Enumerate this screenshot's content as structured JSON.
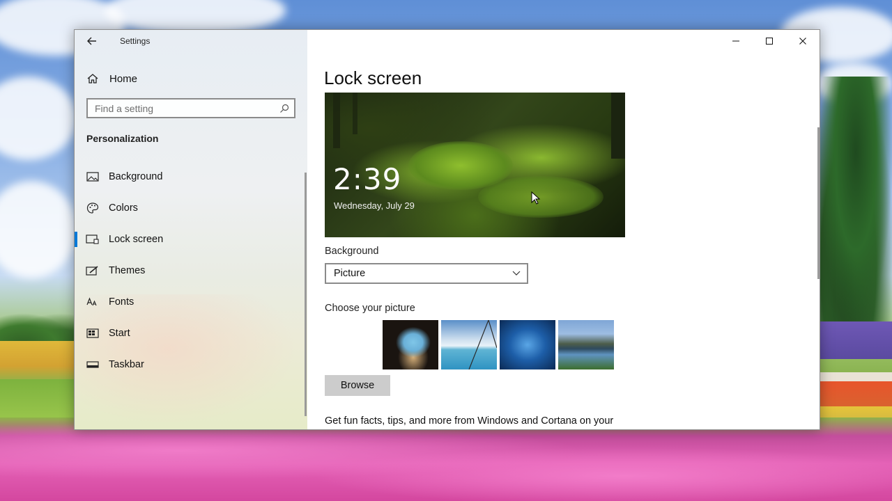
{
  "window": {
    "title": "Settings",
    "caption": {
      "minimize_icon": "minimize-icon",
      "maximize_icon": "maximize-icon",
      "close_icon": "close-icon"
    }
  },
  "sidebar": {
    "home_label": "Home",
    "search": {
      "placeholder": "Find a setting",
      "value": ""
    },
    "section_title": "Personalization",
    "items": [
      {
        "label": "Background",
        "icon": "picture-icon",
        "active": false
      },
      {
        "label": "Colors",
        "icon": "palette-icon",
        "active": false
      },
      {
        "label": "Lock screen",
        "icon": "lock-screen-icon",
        "active": true
      },
      {
        "label": "Themes",
        "icon": "brush-icon",
        "active": false
      },
      {
        "label": "Fonts",
        "icon": "font-icon",
        "active": false
      },
      {
        "label": "Start",
        "icon": "start-icon",
        "active": false
      },
      {
        "label": "Taskbar",
        "icon": "taskbar-icon",
        "active": false
      }
    ]
  },
  "main": {
    "page_title": "Lock screen",
    "preview": {
      "time": "2:39",
      "date": "Wednesday, July 29"
    },
    "background_label": "Background",
    "background_value": "Picture",
    "choose_label": "Choose your picture",
    "browse_label": "Browse",
    "fun_facts_text": "Get fun facts, tips, and more from Windows and Cortana on your"
  },
  "colors": {
    "accent": "#0078d7",
    "browse_bg": "#cccccc"
  }
}
